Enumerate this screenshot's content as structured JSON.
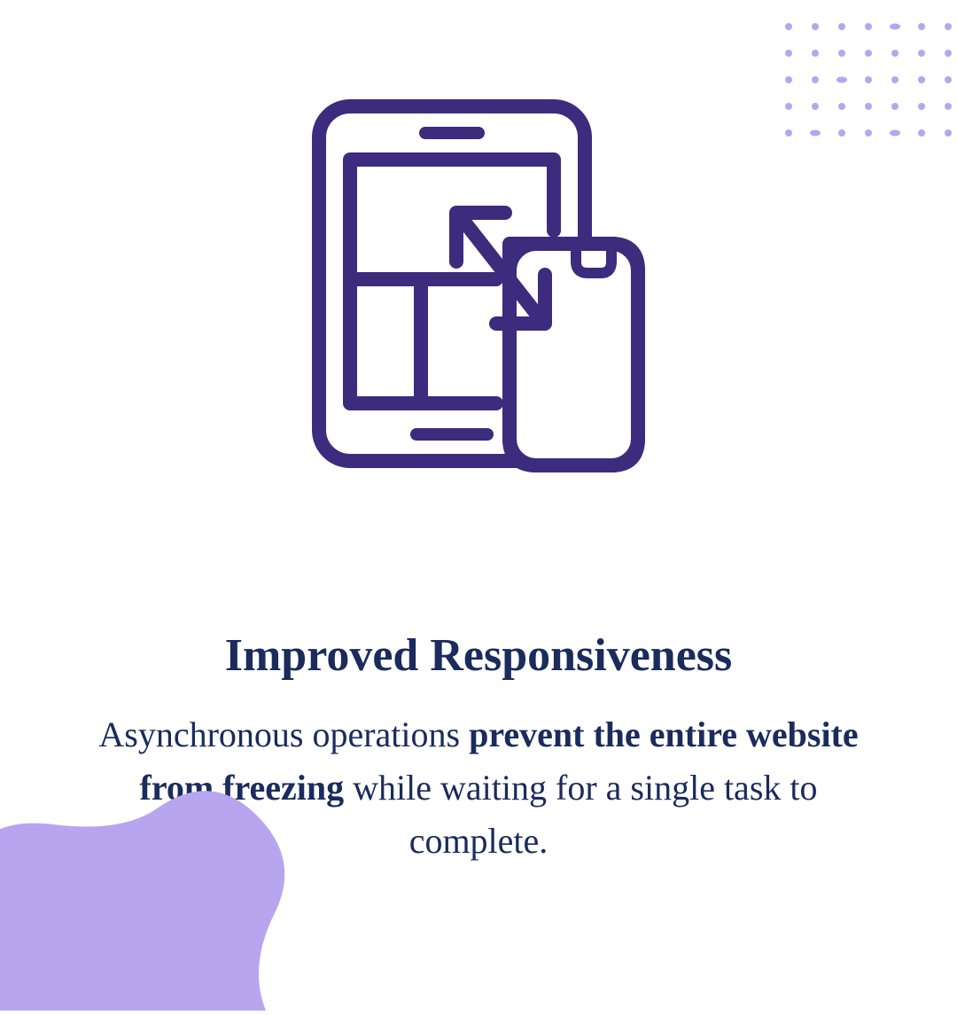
{
  "heading": "Improved Responsiveness",
  "body_pre": "Asynchronous operations ",
  "body_bold": "prevent the entire website from freezing",
  "body_post": " while waiting for a single task to complete.",
  "colors": {
    "icon": "#3d2b7d",
    "text": "#1a2b5c",
    "accent": "#b8a5f0"
  }
}
